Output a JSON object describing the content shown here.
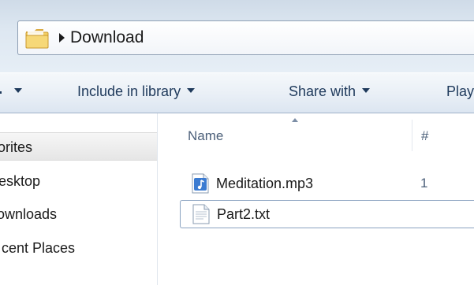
{
  "window": {
    "address": {
      "location": "Download"
    }
  },
  "toolbar": {
    "items": [
      {
        "label": ""
      },
      {
        "label": "Include in library"
      },
      {
        "label": "Share with"
      },
      {
        "label": "Play"
      }
    ]
  },
  "navigation": {
    "items": [
      {
        "label": "orites",
        "selected": true
      },
      {
        "label": "esktop"
      },
      {
        "label": "ownloads"
      },
      {
        "label": "cent Places"
      }
    ]
  },
  "file_list": {
    "columns": [
      {
        "label": "Name",
        "sorted": "ascending"
      },
      {
        "label": "#"
      }
    ],
    "rows": [
      {
        "name": "Meditation.mp3",
        "number": "1",
        "icon": "audio-file-icon"
      },
      {
        "name": "Part2.txt",
        "number": "",
        "icon": "text-file-icon",
        "focused": true
      }
    ]
  },
  "colors": {
    "toolbar_text": "#1e395b",
    "header_text": "#4c607a",
    "selection_gradient_top": "#f6f6f6",
    "selection_gradient_bottom": "#e6e6e6",
    "focus_border": "#8aa2c0"
  }
}
